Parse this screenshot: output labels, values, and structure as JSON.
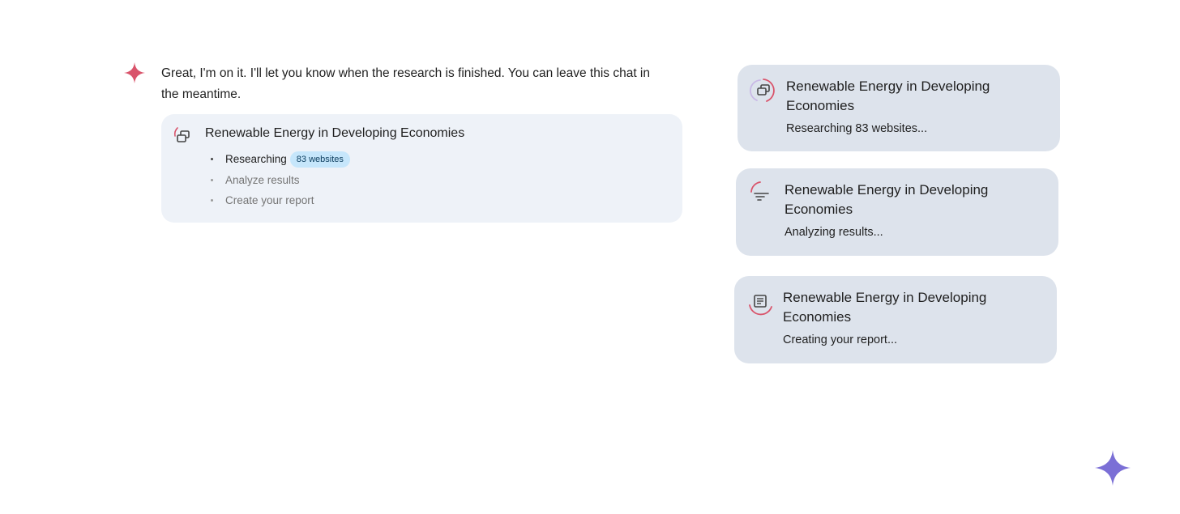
{
  "message": {
    "text": "Great, I'm on it. I'll let you know when the research is finished. You can leave this chat in the meantime.",
    "spark_icon": "gemini-spark-icon",
    "spark_color": "#d9546b"
  },
  "research_card": {
    "title": "Renewable Energy in Developing Economies",
    "icon": "research-progress-icon",
    "steps": [
      {
        "label": "Researching",
        "badge": "83 websites",
        "state": "active"
      },
      {
        "label": "Analyze results",
        "state": "pending"
      },
      {
        "label": "Create your report",
        "state": "pending"
      }
    ]
  },
  "status_cards": [
    {
      "title": "Renewable Energy in Developing Economies",
      "status": "Researching 83 websites...",
      "icon": "browse-windows-icon"
    },
    {
      "title": "Renewable Energy in Developing Economies",
      "status": "Analyzing results...",
      "icon": "analyze-lines-icon"
    },
    {
      "title": "Renewable Energy in Developing Economies",
      "status": "Creating your report...",
      "icon": "document-icon"
    }
  ],
  "colors": {
    "accent_red": "#d9546b",
    "spark_purple": "#7b6fd6",
    "card_bg": "#eef2f8",
    "status_card_bg": "#dde3ec",
    "badge_bg": "#c6e6fb"
  },
  "corner_icon": "gemini-spark-icon"
}
